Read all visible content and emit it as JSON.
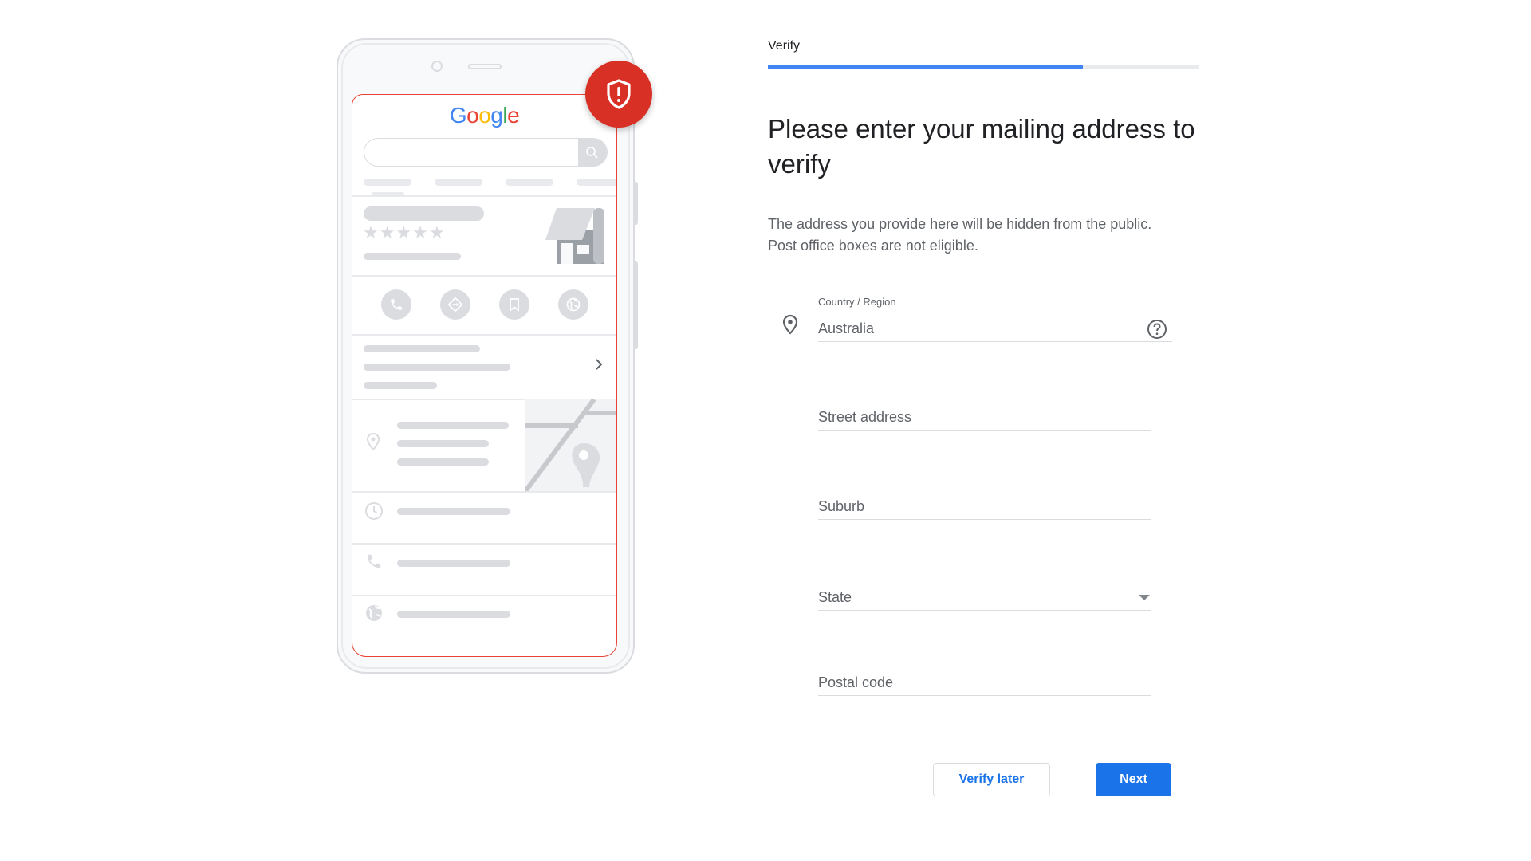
{
  "illustration": {
    "brand_logo_letters": [
      {
        "char": "G",
        "color": "#4285f4"
      },
      {
        "char": "o",
        "color": "#ea4335"
      },
      {
        "char": "o",
        "color": "#fbbc05"
      },
      {
        "char": "g",
        "color": "#4285f4"
      },
      {
        "char": "l",
        "color": "#34a853"
      },
      {
        "char": "e",
        "color": "#ea4335"
      }
    ],
    "badge_icon": "shield-alert-icon",
    "badge_color": "#d93025",
    "action_icons": [
      "phone-icon",
      "directions-icon",
      "bookmark-icon",
      "globe-icon"
    ],
    "info_row_icons": [
      "location-pin-icon",
      "clock-icon",
      "phone-icon",
      "globe-icon"
    ],
    "rating_stars": 5
  },
  "stepper": {
    "label": "Verify",
    "progress_percent": 73,
    "accent_color": "#4285f4"
  },
  "form": {
    "heading": "Please enter your mailing address to verify",
    "description": "The address you provide here will be hidden from the public. Post office boxes are not eligible.",
    "country": {
      "label": "Country / Region",
      "value": "Australia",
      "icon": "location-pin-icon",
      "help_icon": "help-circle-icon"
    },
    "street": {
      "placeholder": "Street address",
      "value": ""
    },
    "suburb": {
      "placeholder": "Suburb",
      "value": ""
    },
    "state": {
      "placeholder": "State",
      "value": "",
      "icon": "dropdown-arrow-icon"
    },
    "postal": {
      "placeholder": "Postal code",
      "value": ""
    }
  },
  "actions": {
    "verify_later_label": "Verify later",
    "next_label": "Next",
    "primary_color": "#1a73e8"
  }
}
